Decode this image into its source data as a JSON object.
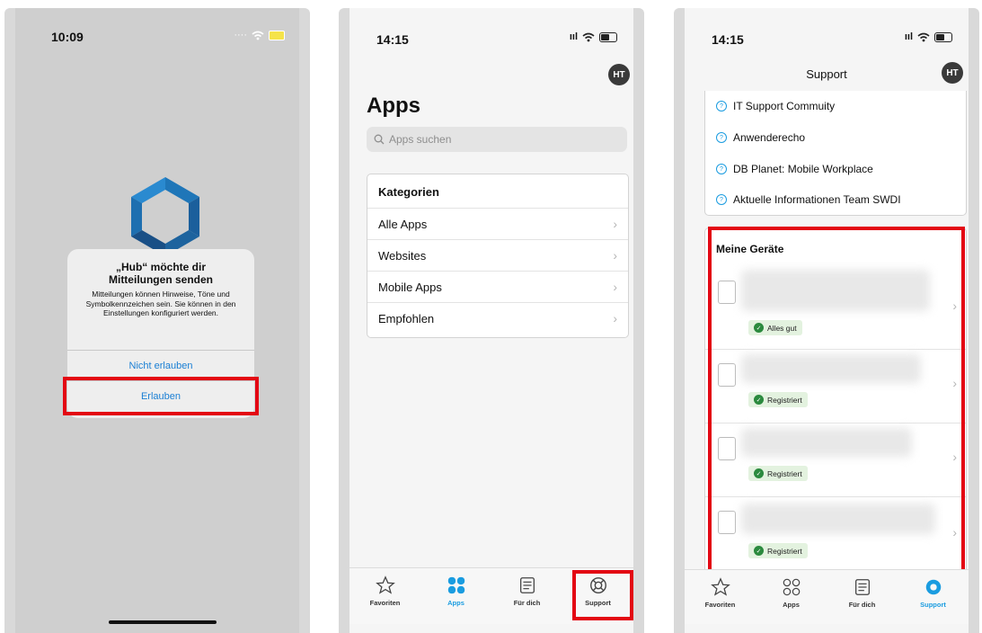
{
  "panel1": {
    "time": "10:09",
    "status_icons": "wifi battery-charging",
    "dialog": {
      "title": "„Hub“ möchte dir Mitteilungen senden",
      "message": "Mitteilungen können Hinweise, Töne und Symbolkennzeichen sein. Sie können in den Einstellungen konfiguriert werden.",
      "deny_label": "Nicht erlauben",
      "allow_label": "Erlauben"
    }
  },
  "panel2": {
    "time": "14:15",
    "avatar": "HT",
    "title": "Apps",
    "search_placeholder": "Apps suchen",
    "categories_header": "Kategorien",
    "categories": [
      "Alle Apps",
      "Websites",
      "Mobile Apps",
      "Empfohlen"
    ],
    "tabs": [
      "Favoriten",
      "Apps",
      "Für dich",
      "Support"
    ]
  },
  "panel3": {
    "time": "14:15",
    "avatar": "HT",
    "title": "Support",
    "links": [
      "IT Support Commuity",
      "Anwenderecho",
      "DB Planet: Mobile Workplace",
      "Aktuelle Informationen Team SWDI"
    ],
    "devices_header": "Meine Geräte",
    "devices": [
      {
        "status": "Alles gut"
      },
      {
        "status": "Registriert"
      },
      {
        "status": "Registriert"
      },
      {
        "status": "Registriert"
      }
    ],
    "tabs": [
      "Favoriten",
      "Apps",
      "Für dich",
      "Support"
    ]
  },
  "colors": {
    "accent": "#1a9ce0",
    "highlight": "#e30613",
    "ok_green": "#2b8a3e"
  }
}
